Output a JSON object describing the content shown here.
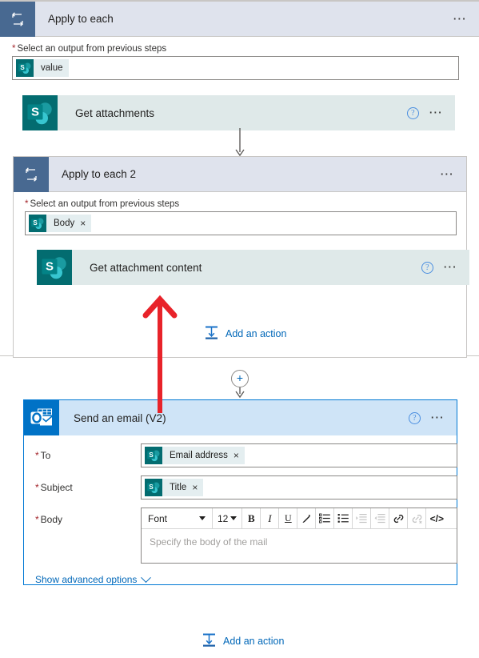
{
  "flow": {
    "apply_to_each": {
      "title": "Apply to each",
      "icon": "loop-icon",
      "help_icon": "help-icon",
      "menu_icon": "ellipsis-icon",
      "input_label": "Select an output from previous steps",
      "required_marker": "*",
      "token": {
        "label": "value",
        "icon": "sharepoint-icon",
        "has_remove": false,
        "remove_glyph": "×"
      },
      "action": {
        "title": "Get attachments",
        "icon": "sharepoint-icon",
        "help_icon": "help-icon",
        "menu_icon": "ellipsis-icon"
      }
    },
    "apply_to_each_2": {
      "title": "Apply to each 2",
      "icon": "loop-icon",
      "menu_icon": "ellipsis-icon",
      "input_label": "Select an output from previous steps",
      "required_marker": "*",
      "token": {
        "label": "Body",
        "icon": "sharepoint-icon",
        "has_remove": true,
        "remove_glyph": "×"
      },
      "action": {
        "title": "Get attachment content",
        "icon": "sharepoint-icon",
        "help_icon": "help-icon",
        "menu_icon": "ellipsis-icon"
      },
      "add_action_label": "Add an action",
      "add_action_icon": "add-action-icon"
    },
    "connector_plus": {
      "glyph": "+",
      "name": "insert-step-button"
    },
    "send_email": {
      "title": "Send an email (V2)",
      "icon": "outlook-icon",
      "help_icon": "help-icon",
      "menu_icon": "ellipsis-icon",
      "selected": true,
      "fields": [
        {
          "label": "To",
          "required_marker": "*",
          "token": {
            "label": "Email address",
            "icon": "sharepoint-icon",
            "remove_glyph": "×"
          }
        },
        {
          "label": "Subject",
          "required_marker": "*",
          "token": {
            "label": "Title",
            "icon": "sharepoint-icon",
            "remove_glyph": "×"
          }
        }
      ],
      "body_field": {
        "label": "Body",
        "required_marker": "*",
        "placeholder": "Specify the body of the mail",
        "toolbar": {
          "font_family": "Font",
          "font_size": "12",
          "buttons": [
            {
              "name": "bold-icon",
              "glyph": "B",
              "enabled": true
            },
            {
              "name": "italic-icon",
              "glyph": "I",
              "enabled": true
            },
            {
              "name": "underline-icon",
              "glyph": "U",
              "enabled": true
            },
            {
              "name": "text-color-icon",
              "glyph": "",
              "enabled": true
            },
            {
              "name": "bulleted-list-icon",
              "glyph": "",
              "enabled": true
            },
            {
              "name": "numbered-list-icon",
              "glyph": "",
              "enabled": true
            },
            {
              "name": "indent-icon",
              "glyph": "",
              "enabled": false
            },
            {
              "name": "outdent-icon",
              "glyph": "",
              "enabled": false
            },
            {
              "name": "insert-link-icon",
              "glyph": "",
              "enabled": true
            },
            {
              "name": "remove-link-icon",
              "glyph": "",
              "enabled": false
            },
            {
              "name": "code-view-icon",
              "glyph": "</>",
              "enabled": true
            }
          ]
        }
      },
      "advanced_options_label": "Show advanced options",
      "advanced_options_icon": "chevron-down-icon"
    },
    "bottom_add_action": {
      "label": "Add an action",
      "icon": "add-action-icon"
    },
    "annotation": {
      "name": "red-arrow-annotation",
      "color": "#e8232a"
    }
  },
  "colors": {
    "scope_header": "#dfe3ed",
    "loop_badge": "#486991",
    "sharepoint": "#036c70",
    "outlook": "#0072c6",
    "action_card": "#dfe9e9",
    "selected_header": "#cfe4f7",
    "selected_border": "#0078d4",
    "link": "#0067b8",
    "required": "#a4262c",
    "annotation_red": "#e8232a"
  }
}
